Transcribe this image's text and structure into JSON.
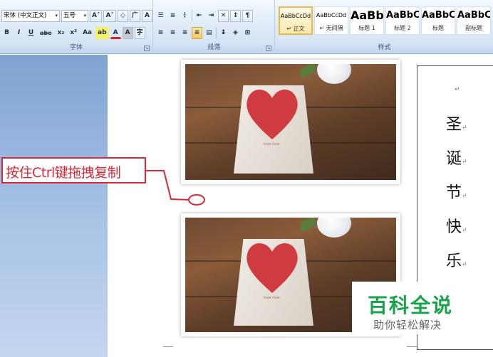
{
  "ribbon": {
    "font_group": {
      "label": "字体",
      "font_name": "宋体 (中文正文)",
      "font_size": "五号",
      "grow_font": "A˄",
      "shrink_font": "A˅",
      "pinyin": "广",
      "char_border": "A",
      "bold": "B",
      "italic": "I",
      "underline": "U",
      "strikethrough": "abe",
      "subscript": "x₂",
      "superscript": "x²",
      "change_case": "Aa",
      "highlight": "ab",
      "font_color": "A",
      "char_shading": "A",
      "enclose_char": "字"
    },
    "paragraph_group": {
      "label": "段落"
    },
    "styles_group": {
      "label": "样式",
      "tiles": [
        {
          "sample": "AaBbCcDd",
          "name": "↵ 正文"
        },
        {
          "sample": "AaBbCcDd",
          "name": "↵ 无间隔"
        },
        {
          "sample": "AaBb",
          "name": "标题 1"
        },
        {
          "sample": "AaBbC",
          "name": "标题 2"
        },
        {
          "sample": "AaBbC",
          "name": "标题"
        },
        {
          "sample": "AaBbC",
          "name": "副标题"
        }
      ]
    }
  },
  "annotation": {
    "text": "按住Ctrl键拖拽复制",
    "color": "#d8283a"
  },
  "textbox": {
    "chars": [
      "圣",
      "诞",
      "节",
      "快",
      "乐"
    ],
    "para_mark": "↵"
  },
  "photo": {
    "card_text": "love love"
  },
  "watermark": {
    "title": "百科全说",
    "subtitle": "助你轻松解决"
  },
  "colors": {
    "ribbon_bg": "#dbe8f6",
    "accent": "#d8283a",
    "watermark_green": "#1aa34a"
  }
}
